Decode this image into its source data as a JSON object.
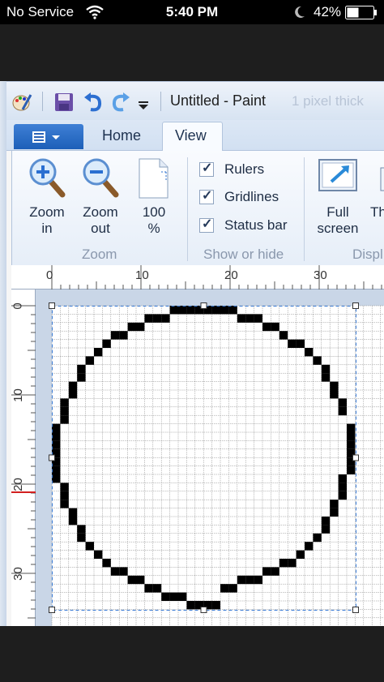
{
  "status_bar": {
    "carrier": "No Service",
    "time": "5:40 PM",
    "battery": "42%"
  },
  "window": {
    "title": "Untitled - Paint",
    "ghost_text": "1 pixel thick"
  },
  "tabs": {
    "home": "Home",
    "view": "View"
  },
  "ribbon": {
    "zoom_in_line1": "Zoom",
    "zoom_in_line2": "in",
    "zoom_out_line1": "Zoom",
    "zoom_out_line2": "out",
    "zoom100_line1": "100",
    "zoom100_line2": "%",
    "zoom_group": "Zoom",
    "rulers": "Rulers",
    "gridlines": "Gridlines",
    "statusbar": "Status bar",
    "show_hide_group": "Show or hide",
    "fullscreen_line1": "Full",
    "fullscreen_line2": "screen",
    "thumbnail_partial": "Th",
    "display_group": "Displ"
  },
  "checkboxes": {
    "rulers": true,
    "gridlines": true,
    "status_bar": true
  },
  "rulers": {
    "h_labels": [
      "0",
      "10",
      "20",
      "30"
    ],
    "v_labels": [
      "0",
      "10",
      "20",
      "30"
    ]
  },
  "colors": {
    "accent": "#1d5fb8",
    "selection": "#3a7bd5",
    "pixel": "#000000",
    "ruler_marker": "#d22020"
  },
  "canvas": {
    "zoom_level": "800%",
    "circle_pixels": [
      [
        14,
        0
      ],
      [
        15,
        0
      ],
      [
        16,
        0
      ],
      [
        17,
        0
      ],
      [
        18,
        0
      ],
      [
        19,
        0
      ],
      [
        20,
        0
      ],
      [
        21,
        0
      ],
      [
        11,
        1
      ],
      [
        12,
        1
      ],
      [
        13,
        1
      ],
      [
        22,
        1
      ],
      [
        23,
        1
      ],
      [
        24,
        1
      ],
      [
        9,
        2
      ],
      [
        10,
        2
      ],
      [
        25,
        2
      ],
      [
        26,
        2
      ],
      [
        7,
        3
      ],
      [
        8,
        3
      ],
      [
        27,
        3
      ],
      [
        6,
        4
      ],
      [
        28,
        4
      ],
      [
        29,
        4
      ],
      [
        5,
        5
      ],
      [
        30,
        5
      ],
      [
        4,
        6
      ],
      [
        31,
        6
      ],
      [
        3,
        7
      ],
      [
        3,
        8
      ],
      [
        32,
        7
      ],
      [
        32,
        8
      ],
      [
        2,
        9
      ],
      [
        2,
        10
      ],
      [
        33,
        9
      ],
      [
        33,
        10
      ],
      [
        1,
        11
      ],
      [
        1,
        12
      ],
      [
        1,
        13
      ],
      [
        34,
        11
      ],
      [
        34,
        12
      ],
      [
        0,
        14
      ],
      [
        0,
        15
      ],
      [
        0,
        16
      ],
      [
        0,
        17
      ],
      [
        0,
        18
      ],
      [
        0,
        19
      ],
      [
        0,
        20
      ],
      [
        35,
        14
      ],
      [
        35,
        15
      ],
      [
        35,
        16
      ],
      [
        35,
        17
      ],
      [
        35,
        18
      ],
      [
        35,
        19
      ],
      [
        1,
        21
      ],
      [
        1,
        22
      ],
      [
        1,
        23
      ],
      [
        34,
        20
      ],
      [
        34,
        21
      ],
      [
        34,
        22
      ],
      [
        2,
        24
      ],
      [
        2,
        25
      ],
      [
        33,
        23
      ],
      [
        33,
        24
      ],
      [
        3,
        26
      ],
      [
        3,
        27
      ],
      [
        32,
        25
      ],
      [
        32,
        26
      ],
      [
        4,
        28
      ],
      [
        31,
        27
      ],
      [
        5,
        29
      ],
      [
        6,
        30
      ],
      [
        29,
        29
      ],
      [
        30,
        28
      ],
      [
        7,
        31
      ],
      [
        8,
        31
      ],
      [
        27,
        30
      ],
      [
        28,
        30
      ],
      [
        9,
        32
      ],
      [
        10,
        32
      ],
      [
        25,
        31
      ],
      [
        26,
        31
      ],
      [
        11,
        33
      ],
      [
        12,
        33
      ],
      [
        22,
        32
      ],
      [
        23,
        32
      ],
      [
        24,
        32
      ],
      [
        13,
        34
      ],
      [
        14,
        34
      ],
      [
        15,
        34
      ],
      [
        20,
        33
      ],
      [
        21,
        33
      ],
      [
        16,
        35
      ],
      [
        17,
        35
      ],
      [
        18,
        35
      ],
      [
        19,
        35
      ]
    ]
  }
}
